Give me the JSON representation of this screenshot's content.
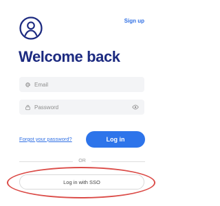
{
  "header": {
    "logo_icon": "user-circle-icon",
    "signup_label": "Sign up"
  },
  "title": "Welcome back",
  "form": {
    "email": {
      "icon": "at-sign-icon",
      "placeholder": "Email",
      "value": ""
    },
    "password": {
      "icon": "lock-icon",
      "placeholder": "Password",
      "value": "",
      "toggle_icon": "eye-icon"
    },
    "forgot_label": "Forgot your password?",
    "login_label": "Log in",
    "divider_label": "OR",
    "sso_label": "Log in with SSO"
  },
  "colors": {
    "title": "#1c2a80",
    "link": "#2f6fe4",
    "primary_button": "#2d74ea",
    "annotation": "#db4b47"
  }
}
